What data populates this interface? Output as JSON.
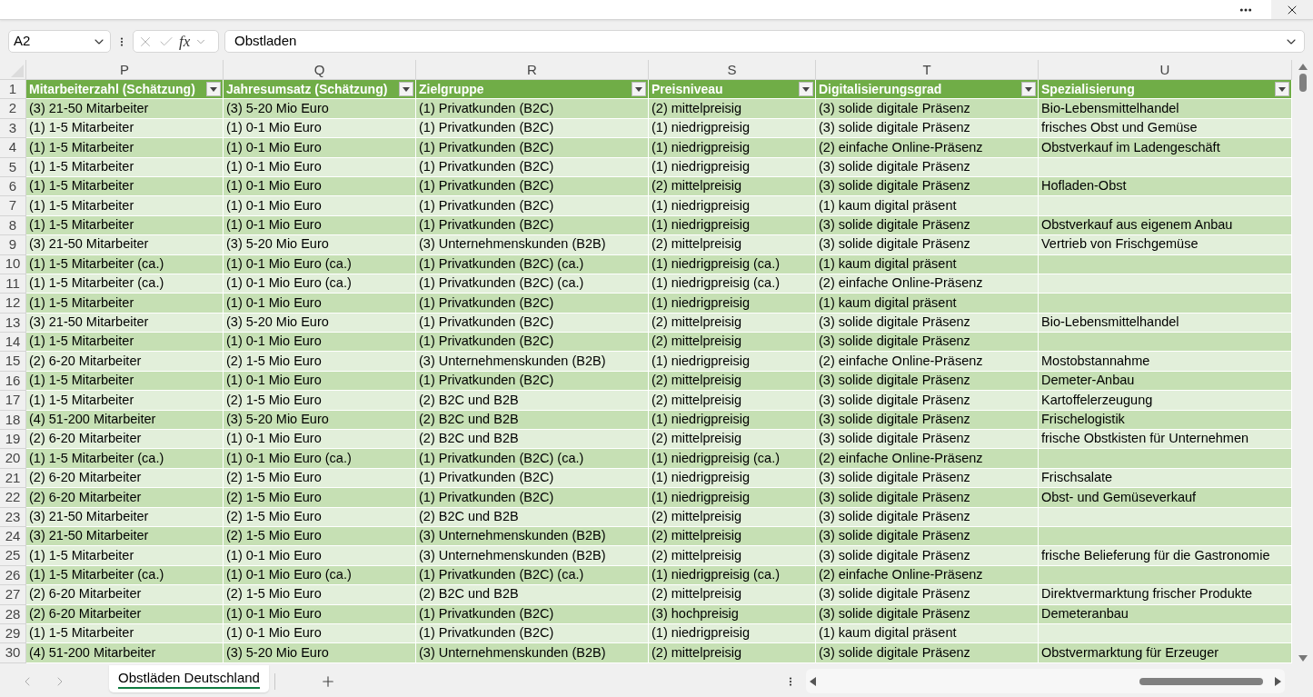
{
  "formula_bar": {
    "name_box": "A2",
    "function_button": "fx",
    "formula": "Obstladen"
  },
  "sheet": {
    "columns": [
      {
        "letter": "P",
        "header": "Mitarbeiterzahl (Schätzung)"
      },
      {
        "letter": "Q",
        "header": "Jahresumsatz (Schätzung)"
      },
      {
        "letter": "R",
        "header": "Zielgruppe"
      },
      {
        "letter": "S",
        "header": "Preisniveau"
      },
      {
        "letter": "T",
        "header": "Digitalisierungsgrad"
      },
      {
        "letter": "U",
        "header": "Spezialisierung"
      }
    ],
    "header_row_number": "1",
    "rows": [
      {
        "number": "2",
        "cells": [
          "(3) 21-50 Mitarbeiter",
          "(3) 5-20 Mio Euro",
          "(1) Privatkunden (B2C)",
          "(2) mittelpreisig",
          "(3) solide digitale Präsenz",
          "Bio-Lebensmittelhandel"
        ]
      },
      {
        "number": "3",
        "cells": [
          "(1) 1-5 Mitarbeiter",
          "(1) 0-1 Mio Euro",
          "(1) Privatkunden (B2C)",
          "(1) niedrigpreisig",
          "(3) solide digitale Präsenz",
          "frisches Obst und Gemüse"
        ]
      },
      {
        "number": "4",
        "cells": [
          "(1) 1-5 Mitarbeiter",
          "(1) 0-1 Mio Euro",
          "(1) Privatkunden (B2C)",
          "(1) niedrigpreisig",
          "(2) einfache Online-Präsenz",
          "Obstverkauf im Ladengeschäft"
        ]
      },
      {
        "number": "5",
        "cells": [
          "(1) 1-5 Mitarbeiter",
          "(1) 0-1 Mio Euro",
          "(1) Privatkunden (B2C)",
          "(1) niedrigpreisig",
          "(3) solide digitale Präsenz",
          null
        ]
      },
      {
        "number": "6",
        "cells": [
          "(1) 1-5 Mitarbeiter",
          "(1) 0-1 Mio Euro",
          "(1) Privatkunden (B2C)",
          "(2) mittelpreisig",
          "(3) solide digitale Präsenz",
          "Hofladen-Obst"
        ]
      },
      {
        "number": "7",
        "cells": [
          "(1) 1-5 Mitarbeiter",
          "(1) 0-1 Mio Euro",
          "(1) Privatkunden (B2C)",
          "(1) niedrigpreisig",
          "(1) kaum digital präsent",
          null
        ]
      },
      {
        "number": "8",
        "cells": [
          "(1) 1-5 Mitarbeiter",
          "(1) 0-1 Mio Euro",
          "(1) Privatkunden (B2C)",
          "(1) niedrigpreisig",
          "(3) solide digitale Präsenz",
          "Obstverkauf aus eigenem Anbau"
        ]
      },
      {
        "number": "9",
        "cells": [
          "(3) 21-50 Mitarbeiter",
          "(3) 5-20 Mio Euro",
          "(3) Unternehmenskunden (B2B)",
          "(2) mittelpreisig",
          "(3) solide digitale Präsenz",
          "Vertrieb von Frischgemüse"
        ]
      },
      {
        "number": "10",
        "cells": [
          "(1) 1-5 Mitarbeiter (ca.)",
          "(1) 0-1 Mio Euro (ca.)",
          "(1) Privatkunden (B2C) (ca.)",
          "(1) niedrigpreisig (ca.)",
          "(1) kaum digital präsent",
          null
        ]
      },
      {
        "number": "11",
        "cells": [
          "(1) 1-5 Mitarbeiter (ca.)",
          "(1) 0-1 Mio Euro (ca.)",
          "(1) Privatkunden (B2C) (ca.)",
          "(1) niedrigpreisig (ca.)",
          "(2) einfache Online-Präsenz",
          null
        ]
      },
      {
        "number": "12",
        "cells": [
          "(1) 1-5 Mitarbeiter",
          "(1) 0-1 Mio Euro",
          "(1) Privatkunden (B2C)",
          "(1) niedrigpreisig",
          "(1) kaum digital präsent",
          null
        ]
      },
      {
        "number": "13",
        "cells": [
          "(3) 21-50 Mitarbeiter",
          "(3) 5-20 Mio Euro",
          "(1) Privatkunden (B2C)",
          "(2) mittelpreisig",
          "(3) solide digitale Präsenz",
          "Bio-Lebensmittelhandel"
        ]
      },
      {
        "number": "14",
        "cells": [
          "(1) 1-5 Mitarbeiter",
          "(1) 0-1 Mio Euro",
          "(1) Privatkunden (B2C)",
          "(2) mittelpreisig",
          "(3) solide digitale Präsenz",
          null
        ]
      },
      {
        "number": "15",
        "cells": [
          "(2) 6-20 Mitarbeiter",
          "(2) 1-5 Mio Euro",
          "(3) Unternehmenskunden (B2B)",
          "(1) niedrigpreisig",
          "(2) einfache Online-Präsenz",
          "Mostobstannahme"
        ]
      },
      {
        "number": "16",
        "cells": [
          "(1) 1-5 Mitarbeiter",
          "(1) 0-1 Mio Euro",
          "(1) Privatkunden (B2C)",
          "(2) mittelpreisig",
          "(3) solide digitale Präsenz",
          "Demeter-Anbau"
        ]
      },
      {
        "number": "17",
        "cells": [
          "(1) 1-5 Mitarbeiter",
          "(2) 1-5 Mio Euro",
          "(2) B2C und B2B",
          "(2) mittelpreisig",
          "(3) solide digitale Präsenz",
          "Kartoffelerzeugung"
        ]
      },
      {
        "number": "18",
        "cells": [
          "(4) 51-200 Mitarbeiter",
          "(3) 5-20 Mio Euro",
          "(2) B2C und B2B",
          "(1) niedrigpreisig",
          "(3) solide digitale Präsenz",
          "Frischelogistik"
        ]
      },
      {
        "number": "19",
        "cells": [
          "(2) 6-20 Mitarbeiter",
          "(1) 0-1 Mio Euro",
          "(2) B2C und B2B",
          "(2) mittelpreisig",
          "(3) solide digitale Präsenz",
          "frische Obstkisten für Unternehmen"
        ]
      },
      {
        "number": "20",
        "cells": [
          "(1) 1-5 Mitarbeiter (ca.)",
          "(1) 0-1 Mio Euro (ca.)",
          "(1) Privatkunden (B2C) (ca.)",
          "(1) niedrigpreisig (ca.)",
          "(2) einfache Online-Präsenz",
          null
        ]
      },
      {
        "number": "21",
        "cells": [
          "(2) 6-20 Mitarbeiter",
          "(2) 1-5 Mio Euro",
          "(1) Privatkunden (B2C)",
          "(1) niedrigpreisig",
          "(3) solide digitale Präsenz",
          "Frischsalate"
        ]
      },
      {
        "number": "22",
        "cells": [
          "(2) 6-20 Mitarbeiter",
          "(2) 1-5 Mio Euro",
          "(1) Privatkunden (B2C)",
          "(1) niedrigpreisig",
          "(3) solide digitale Präsenz",
          "Obst- und Gemüseverkauf"
        ]
      },
      {
        "number": "23",
        "cells": [
          "(3) 21-50 Mitarbeiter",
          "(2) 1-5 Mio Euro",
          "(2) B2C und B2B",
          "(2) mittelpreisig",
          "(3) solide digitale Präsenz",
          null
        ]
      },
      {
        "number": "24",
        "cells": [
          "(3) 21-50 Mitarbeiter",
          "(2) 1-5 Mio Euro",
          "(3) Unternehmenskunden (B2B)",
          "(2) mittelpreisig",
          "(3) solide digitale Präsenz",
          null
        ]
      },
      {
        "number": "25",
        "cells": [
          "(1) 1-5 Mitarbeiter",
          "(1) 0-1 Mio Euro",
          "(3) Unternehmenskunden (B2B)",
          "(2) mittelpreisig",
          "(3) solide digitale Präsenz",
          "frische Belieferung für die Gastronomie"
        ]
      },
      {
        "number": "26",
        "cells": [
          "(1) 1-5 Mitarbeiter (ca.)",
          "(1) 0-1 Mio Euro (ca.)",
          "(1) Privatkunden (B2C) (ca.)",
          "(1) niedrigpreisig (ca.)",
          "(2) einfache Online-Präsenz",
          null
        ]
      },
      {
        "number": "27",
        "cells": [
          "(2) 6-20 Mitarbeiter",
          "(2) 1-5 Mio Euro",
          "(2) B2C und B2B",
          "(2) mittelpreisig",
          "(3) solide digitale Präsenz",
          "Direktvermarktung frischer Produkte"
        ]
      },
      {
        "number": "28",
        "cells": [
          "(2) 6-20 Mitarbeiter",
          "(1) 0-1 Mio Euro",
          "(1) Privatkunden (B2C)",
          "(3) hochpreisig",
          "(3) solide digitale Präsenz",
          "Demeteranbau"
        ]
      },
      {
        "number": "29",
        "cells": [
          "(1) 1-5 Mitarbeiter",
          "(1) 0-1 Mio Euro",
          "(1) Privatkunden (B2C)",
          "(1) niedrigpreisig",
          "(1) kaum digital präsent",
          null
        ]
      },
      {
        "number": "30",
        "cells": [
          "(4) 51-200 Mitarbeiter",
          "(3) 5-20 Mio Euro",
          "(3) Unternehmenskunden (B2B)",
          "(2) mittelpreisig",
          "(3) solide digitale Präsenz",
          "Obstvermarktung für Erzeuger"
        ]
      }
    ]
  },
  "sheet_tabs": [
    {
      "label": "Obstläden Deutschland",
      "selected": true
    }
  ]
}
